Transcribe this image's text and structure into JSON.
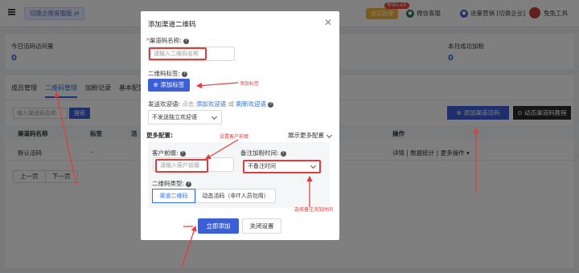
{
  "topbar": {
    "switch_label": "切换企微客服版 ⇄",
    "member_label": "会员管理",
    "upgrade_badge": "等待0.9天",
    "wechat_service": "微信客服",
    "marketing": "进量营销 [切换企业]",
    "username": "兔兔工具"
  },
  "stats": {
    "today_visits_label": "今日活码访问量",
    "today_visits_value": "0",
    "month_fans_label": "本月成功加粉",
    "month_fans_value": "0"
  },
  "tabs": [
    "成员管理",
    "二维码管理",
    "加粉记录",
    "基本配置"
  ],
  "toolbar": {
    "search_placeholder": "输入渠道码名称",
    "search_button": "搜索",
    "add_channel_button": "添加渠道活码",
    "tutorial_button": "动态渠道码教程"
  },
  "table": {
    "headers": [
      "渠道码名称",
      "标签",
      "活",
      "操作"
    ],
    "row": {
      "name": "默认活码",
      "tag": "-",
      "ops": "详情 | 数据统计 | 更多操作 ▾"
    }
  },
  "pager": {
    "prev": "上一页",
    "next": "下一页"
  },
  "modal": {
    "title": "添加渠道二维码",
    "close": "✕",
    "name_label": "渠道码名称:",
    "name_placeholder": "请输入二维码名称",
    "tag_label": "二维码标签:",
    "add_tag_button": "添加标签",
    "welcome_label": "发送欢迎语:",
    "welcome_click": "点击",
    "welcome_add_link": "添加欢迎语",
    "welcome_or": "或",
    "welcome_refresh_link": "刷新欢迎语",
    "welcome_select_value": "不发送独立欢迎语",
    "more_config_label": "更多配置:",
    "expand_more": "展示更多配置",
    "prefix_label": "客户前缀:",
    "prefix_placeholder": "请输入客户前缀",
    "remark_time_label": "备注加粉时间:",
    "remark_time_value": "不备注时间",
    "qr_type_label": "二维码类型:",
    "qr_type_options": [
      "渠道二维码",
      "动态活码（非IT人员勿用）"
    ],
    "submit_button": "立即添加",
    "close_button": "关闭设置"
  },
  "annotations": {
    "add_tag": "添加标签",
    "set_prefix": "设置客户前缀",
    "choose_time": "选择备注添加时间"
  },
  "colors": {
    "primary": "#3d5fd6",
    "link": "#2f6fe0",
    "annotation": "#e23b3b",
    "member_gold": "#f4b73e"
  }
}
